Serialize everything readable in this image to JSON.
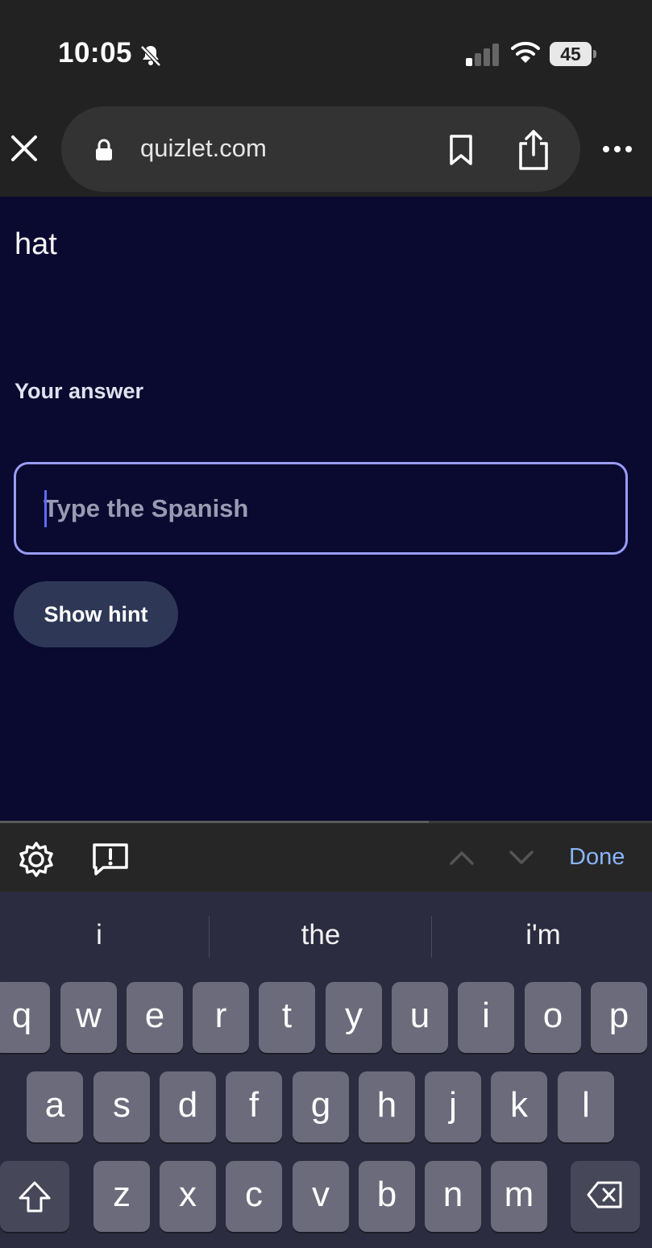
{
  "status_bar": {
    "time": "10:05",
    "battery": "45",
    "icons": [
      "bell-slash-icon",
      "signal-icon",
      "wifi-icon",
      "battery-icon"
    ]
  },
  "browser": {
    "url": "quizlet.com",
    "icons": [
      "close-icon",
      "lock-icon",
      "bookmark-icon",
      "share-icon",
      "more-icon"
    ]
  },
  "question": {
    "term": "hat",
    "answer_label": "Your answer",
    "input_placeholder": "Type the Spanish",
    "input_value": "",
    "hint_button": "Show hint"
  },
  "accessory": {
    "done_label": "Done",
    "icons": [
      "gear-icon",
      "report-icon",
      "chevron-up-icon",
      "chevron-down-icon"
    ]
  },
  "keyboard": {
    "suggestions": [
      "i",
      "the",
      "i'm"
    ],
    "row1": [
      "q",
      "w",
      "e",
      "r",
      "t",
      "y",
      "u",
      "i",
      "o",
      "p"
    ],
    "row2": [
      "a",
      "s",
      "d",
      "f",
      "g",
      "h",
      "j",
      "k",
      "l"
    ],
    "row3": [
      "z",
      "x",
      "c",
      "v",
      "b",
      "n",
      "m"
    ]
  },
  "colors": {
    "page_bg": "#0a0930",
    "input_border": "#9a9cf5",
    "hint_button_bg": "#2e3856",
    "done_text": "#8ab4f8",
    "chrome_bg": "#222222"
  }
}
